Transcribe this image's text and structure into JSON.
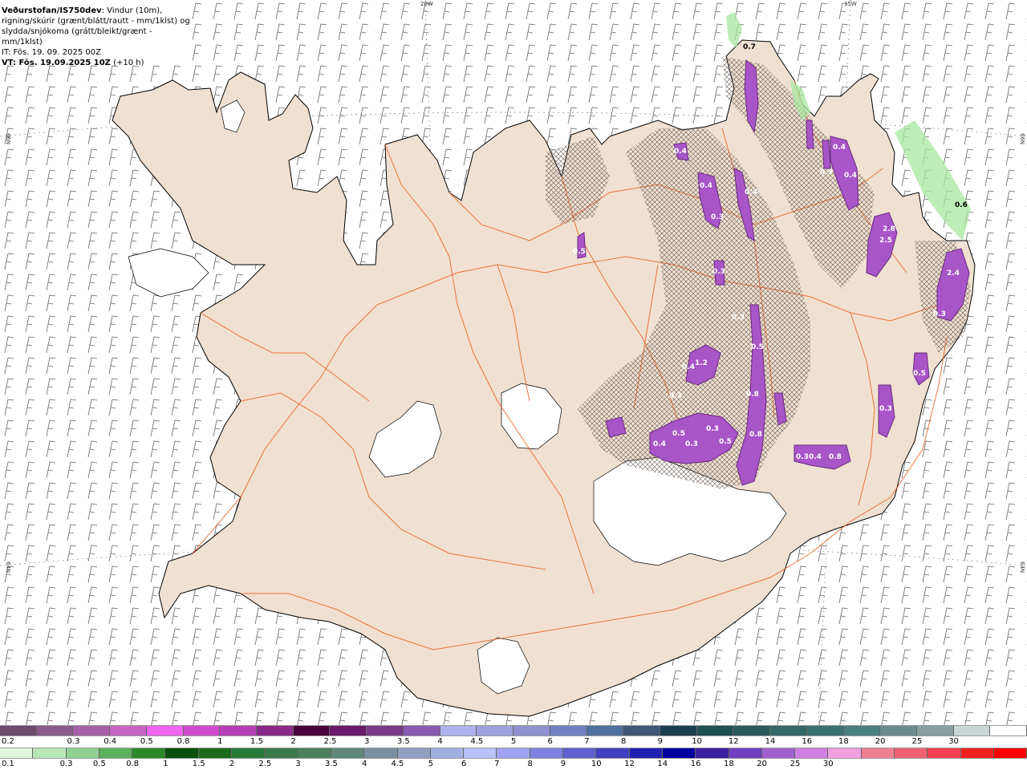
{
  "title": {
    "source": "Veðurstofan/IS750dev",
    "description_part": ": Vindur (10m),",
    "line2": "rigning/skúrir (grænt/blátt/rautt - mm/1klst) og",
    "line3": "slydda/snjókoma (grátt/bleikt/grænt - mm/1klst)",
    "init_time": "IT: Fös. 19. 09. 2025 00Z",
    "valid_label": "VT: Fös. 19.09.2025 10Z",
    "valid_offset": " (+10 h)"
  },
  "grid_labels": {
    "lon_20w": "20W",
    "lon_15w": "15W",
    "lat_66n_left": "66N",
    "lat_66n_right": "66N",
    "lat_64n_left": "64N",
    "lat_64n_right": "64N"
  },
  "map_values": [
    "0.7",
    "0.6",
    "0.4",
    "0.4",
    "0.4",
    "0.3",
    "0.4",
    "0.3",
    "0.5",
    "0.4",
    "0.3",
    "0.5",
    "0.8",
    "0.3",
    "2.4",
    "2.8",
    "2.5",
    "0.3",
    "0.4",
    "1.2",
    "0.3",
    "0.5",
    "0.4",
    "0.3",
    "0.5",
    "0.3",
    "0.4",
    "0.8",
    "0.8",
    "0.3",
    "0.5",
    "0.3"
  ],
  "legend_snow": {
    "colors": [
      "#6b4a6b",
      "#8a5a8a",
      "#a860a8",
      "#c466c4",
      "#ee66ee",
      "#d04ad0",
      "#b540b5",
      "#8a2a8a",
      "#4a003a",
      "#6a1a6a",
      "#7a3a8a",
      "#8a5ab0",
      "#b0b0f0",
      "#a0a0e0",
      "#9090d0",
      "#7080c0",
      "#5070a0",
      "#405878",
      "#1a4050",
      "#1e5050",
      "#2a5a5a",
      "#356868",
      "#3a7070",
      "#4a8080",
      "#6a8c8c",
      "#8aa0a0",
      "#c8d6d6",
      "#ffffff"
    ],
    "labels": [
      "0.2",
      "0.3",
      "0.4",
      "0.5",
      "0.8",
      "1",
      "1.5",
      "2",
      "2.5",
      "3",
      "3.5",
      "4",
      "4.5",
      "5",
      "6",
      "7",
      "8",
      "9",
      "10",
      "12",
      "14",
      "16",
      "18",
      "20",
      "25",
      "30"
    ]
  },
  "legend_rain": {
    "colors": [
      "#dff5df",
      "#b8e8b8",
      "#90d090",
      "#5cb05c",
      "#2a8a2a",
      "#0a500a",
      "#1a6a1a",
      "#2a7a3a",
      "#3a7a4a",
      "#4a8060",
      "#608878",
      "#7890a0",
      "#90a0c0",
      "#a0b0e0",
      "#b8c0f8",
      "#a0a0f0",
      "#8080e0",
      "#6060d0",
      "#4040c0",
      "#2020b0",
      "#0000a0",
      "#3a20a0",
      "#7040c0",
      "#a060d0",
      "#d080e0",
      "#f0a0e0",
      "#f08090",
      "#f06070",
      "#f04050",
      "#f02020",
      "#ff0000"
    ],
    "labels": [
      "0.1",
      "0.3",
      "0.5",
      "0.8",
      "1",
      "1.5",
      "2",
      "2.5",
      "3",
      "3.5",
      "4",
      "4.5",
      "5",
      "6",
      "7",
      "8",
      "9",
      "10",
      "12",
      "14",
      "16",
      "18",
      "20",
      "25",
      "30"
    ]
  },
  "colors": {
    "land": "#f0e0d2",
    "coast": "#000000",
    "roads": "#e86020",
    "snow": "#a855c8",
    "rain": "#9fe09f",
    "barbs": "#555555"
  }
}
